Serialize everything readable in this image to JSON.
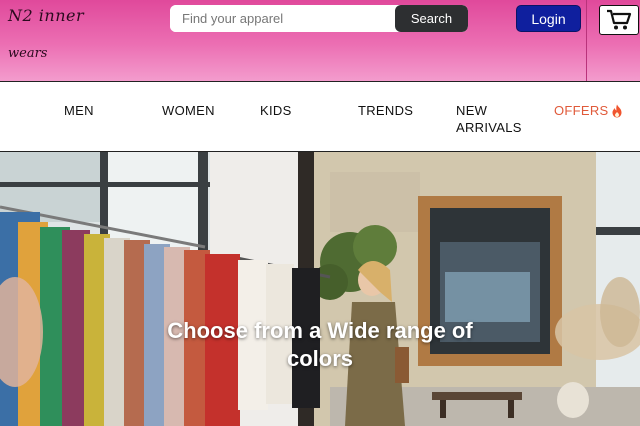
{
  "brand": {
    "line1": "N2 inner",
    "line2": "wears"
  },
  "search": {
    "placeholder": "Find your apparel",
    "button_label": "Search"
  },
  "auth": {
    "login_label": "Login"
  },
  "cart": {
    "icon": "cart-icon"
  },
  "nav": {
    "men": "MEN",
    "women": "WOMEN",
    "kids": "KIDS",
    "trends": "TRENDS",
    "new_line1": "NEW",
    "new_line2": "ARRIVALS",
    "offers": "OFFERS",
    "offers_icon": "flame-icon"
  },
  "hero": {
    "caption_line1": "Choose from a Wide range of",
    "caption_line2": "colors",
    "image": "clothing-store-photo"
  },
  "colors": {
    "header_pink": "#e0499b",
    "search_button": "#2d2f31",
    "login_button": "#0f1f9e",
    "offers_text": "#e05a3a"
  }
}
